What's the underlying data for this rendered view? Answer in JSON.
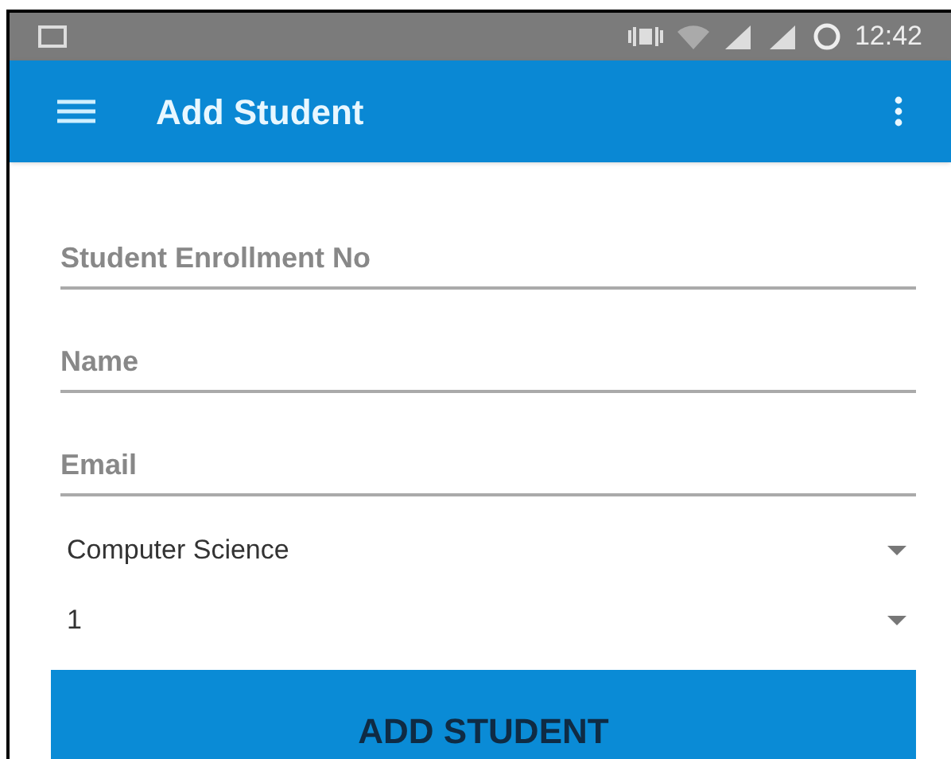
{
  "status_bar": {
    "time": "12:42"
  },
  "app_bar": {
    "title": "Add Student"
  },
  "fields": [
    {
      "placeholder": "Student Enrollment No"
    },
    {
      "placeholder": "Name"
    },
    {
      "placeholder": "Email"
    }
  ],
  "dropdowns": [
    {
      "value": "Computer Science"
    },
    {
      "value": "1"
    }
  ],
  "submit_button": {
    "label": "ADD STUDENT"
  }
}
